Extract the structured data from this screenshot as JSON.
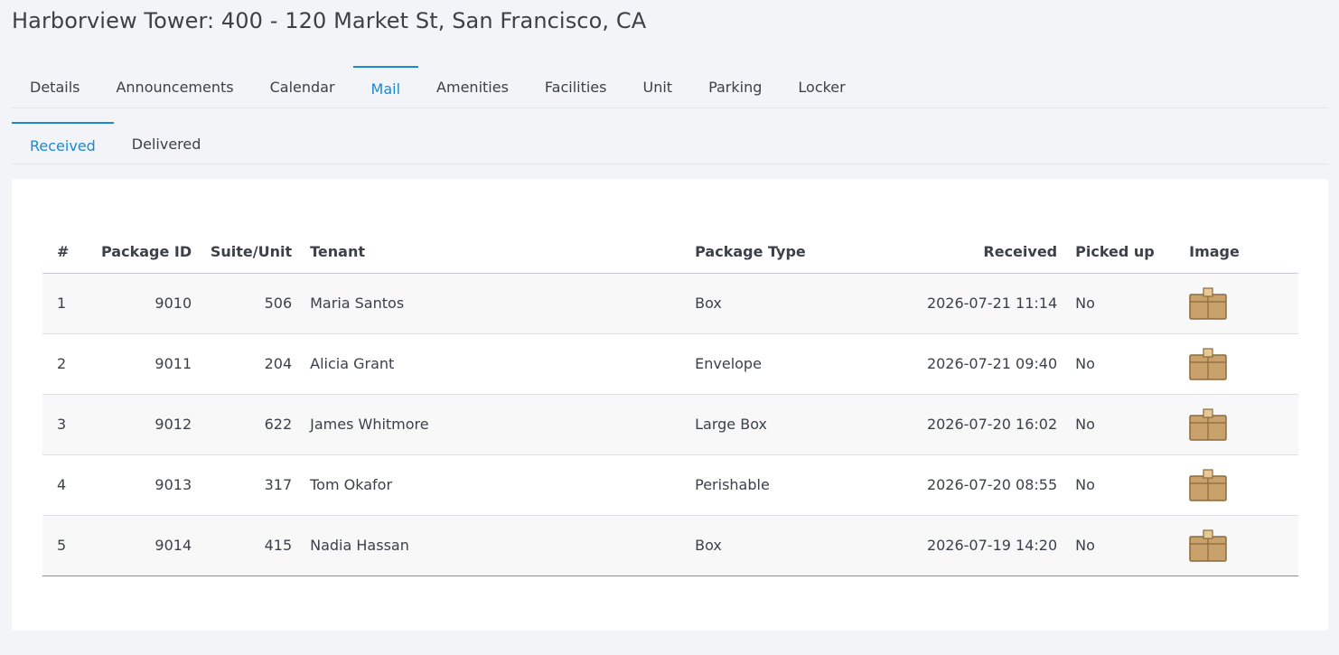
{
  "page": {
    "title": "Harborview Tower: 400 - 120 Market St, San Francisco, CA"
  },
  "tabs": [
    {
      "label": "Details",
      "active": false
    },
    {
      "label": "Announcements",
      "active": false
    },
    {
      "label": "Calendar",
      "active": false
    },
    {
      "label": "Mail",
      "active": true
    },
    {
      "label": "Amenities",
      "active": false
    },
    {
      "label": "Facilities",
      "active": false
    },
    {
      "label": "Unit",
      "active": false
    },
    {
      "label": "Parking",
      "active": false
    },
    {
      "label": "Locker",
      "active": false
    }
  ],
  "subtabs": [
    {
      "label": "Received",
      "active": true
    },
    {
      "label": "Delivered",
      "active": false
    }
  ],
  "table": {
    "headers": {
      "index": "#",
      "package_id": "Package ID",
      "suite_unit": "Suite/Unit",
      "tenant": "Tenant",
      "package_type": "Package Type",
      "received": "Received",
      "picked_up": "Picked up",
      "image": "Image"
    },
    "rows": [
      {
        "index": "1",
        "package_id": "9010",
        "suite_unit": "506",
        "tenant": "Maria Santos",
        "package_type": "Box",
        "received": "2026-07-21 11:14",
        "picked_up": "No",
        "image_icon": "package-box-icon"
      },
      {
        "index": "2",
        "package_id": "9011",
        "suite_unit": "204",
        "tenant": "Alicia Grant",
        "package_type": "Envelope",
        "received": "2026-07-21 09:40",
        "picked_up": "No",
        "image_icon": "package-box-icon"
      },
      {
        "index": "3",
        "package_id": "9012",
        "suite_unit": "622",
        "tenant": "James Whitmore",
        "package_type": "Large Box",
        "received": "2026-07-20 16:02",
        "picked_up": "No",
        "image_icon": "package-box-icon"
      },
      {
        "index": "4",
        "package_id": "9013",
        "suite_unit": "317",
        "tenant": "Tom Okafor",
        "package_type": "Perishable",
        "received": "2026-07-20 08:55",
        "picked_up": "No",
        "image_icon": "package-box-icon"
      },
      {
        "index": "5",
        "package_id": "9014",
        "suite_unit": "415",
        "tenant": "Nadia Hassan",
        "package_type": "Box",
        "received": "2026-07-19 14:20",
        "picked_up": "No",
        "image_icon": "package-box-icon"
      }
    ]
  },
  "colors": {
    "accent": "#1a8ad4",
    "box_fill": "#c9a26b",
    "box_stroke": "#8a6a3e",
    "tape": "#e6c993"
  }
}
